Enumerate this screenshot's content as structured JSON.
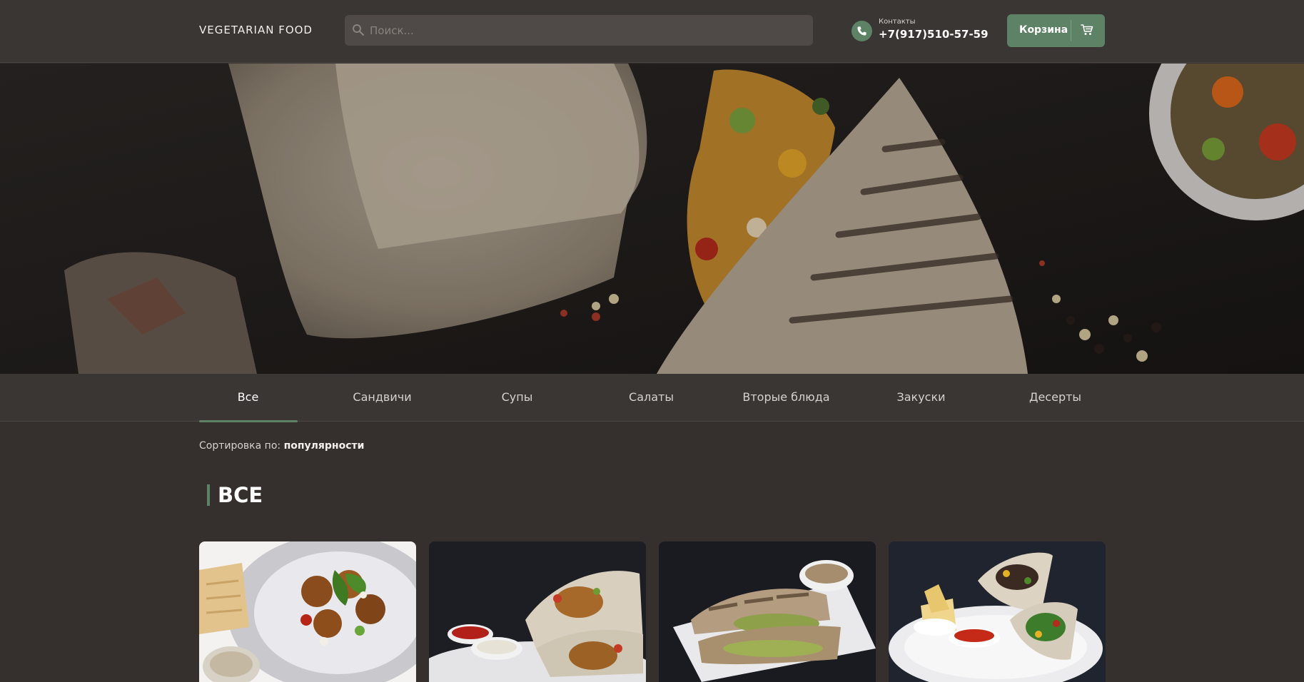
{
  "header": {
    "logo": "VEGETARIAN FOOD",
    "search_placeholder": "Поиск...",
    "contacts_label": "Контакты",
    "phone": "+7(917)510-57-59",
    "cart_label": "Корзина"
  },
  "tabs": [
    "Все",
    "Сандвичи",
    "Супы",
    "Салаты",
    "Вторые блюда",
    "Закуски",
    "Десерты"
  ],
  "active_tab": "Все",
  "sort": {
    "label": "Сортировка по:",
    "value": "популярности"
  },
  "section_title": "ВСЕ",
  "colors": {
    "accent": "#5e8266",
    "background": "#35302e",
    "header": "#3a3634"
  },
  "icons": [
    "search-icon",
    "phone-icon",
    "cart-icon"
  ],
  "products": [
    {
      "image": "falafel-salad-plate"
    },
    {
      "image": "wrap-with-falafel-and-sauces"
    },
    {
      "image": "grilled-wrap-with-sauce"
    },
    {
      "image": "wrap-with-nachos-and-salsa"
    }
  ]
}
